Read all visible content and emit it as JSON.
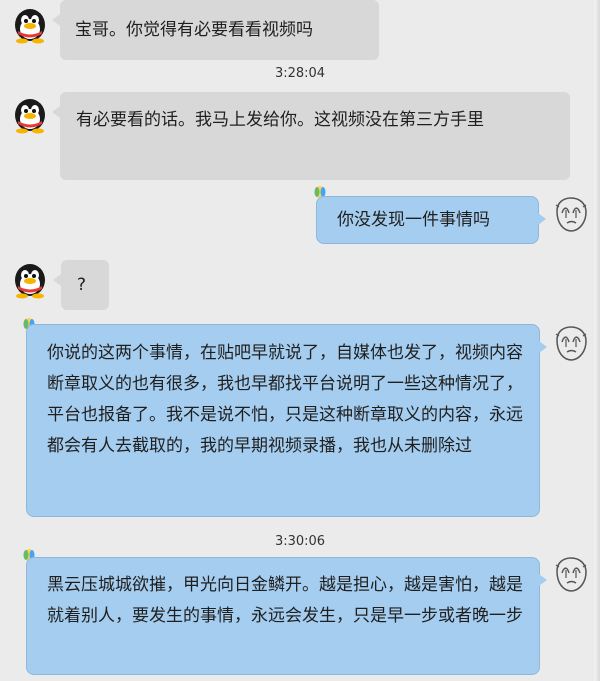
{
  "conversation": {
    "messages": [
      {
        "side": "left",
        "avatar_icon": "qq-penguin-icon",
        "text": "宝哥。你觉得有必要看看视频吗"
      },
      {
        "timestamp": "3:28:04"
      },
      {
        "side": "left",
        "avatar_icon": "qq-penguin-icon",
        "text": "有必要看的话。我马上发给你。这视频没在第三方手里"
      },
      {
        "side": "right",
        "avatar_icon": "sketch-face-icon",
        "text": "你没发现一件事情吗"
      },
      {
        "side": "left",
        "avatar_icon": "qq-penguin-icon",
        "text": "?"
      },
      {
        "side": "right",
        "avatar_icon": "sketch-face-icon",
        "text": "你说的这两个事情，在贴吧早就说了，自媒体也发了，视频内容断章取义的也有很多，我也早都找平台说明了一些这种情况了，平台也报备了。我不是说不怕，只是这种断章取义的内容，永远都会有人去截取的，我的早期视频录播，我也从未删除过"
      },
      {
        "timestamp": "3:30:06"
      },
      {
        "side": "right",
        "avatar_icon": "sketch-face-icon",
        "text": "黑云压城城欲摧，甲光向日金鳞开。越是担心，越是害怕，越是就着别人，要发生的事情，永远会发生，只是早一步或者晚一步"
      }
    ]
  },
  "colors": {
    "background": "#ebebeb",
    "incoming_bubble": "#d8d8d8",
    "outgoing_bubble": "#a5cdef",
    "outgoing_border": "#8db7dc"
  }
}
